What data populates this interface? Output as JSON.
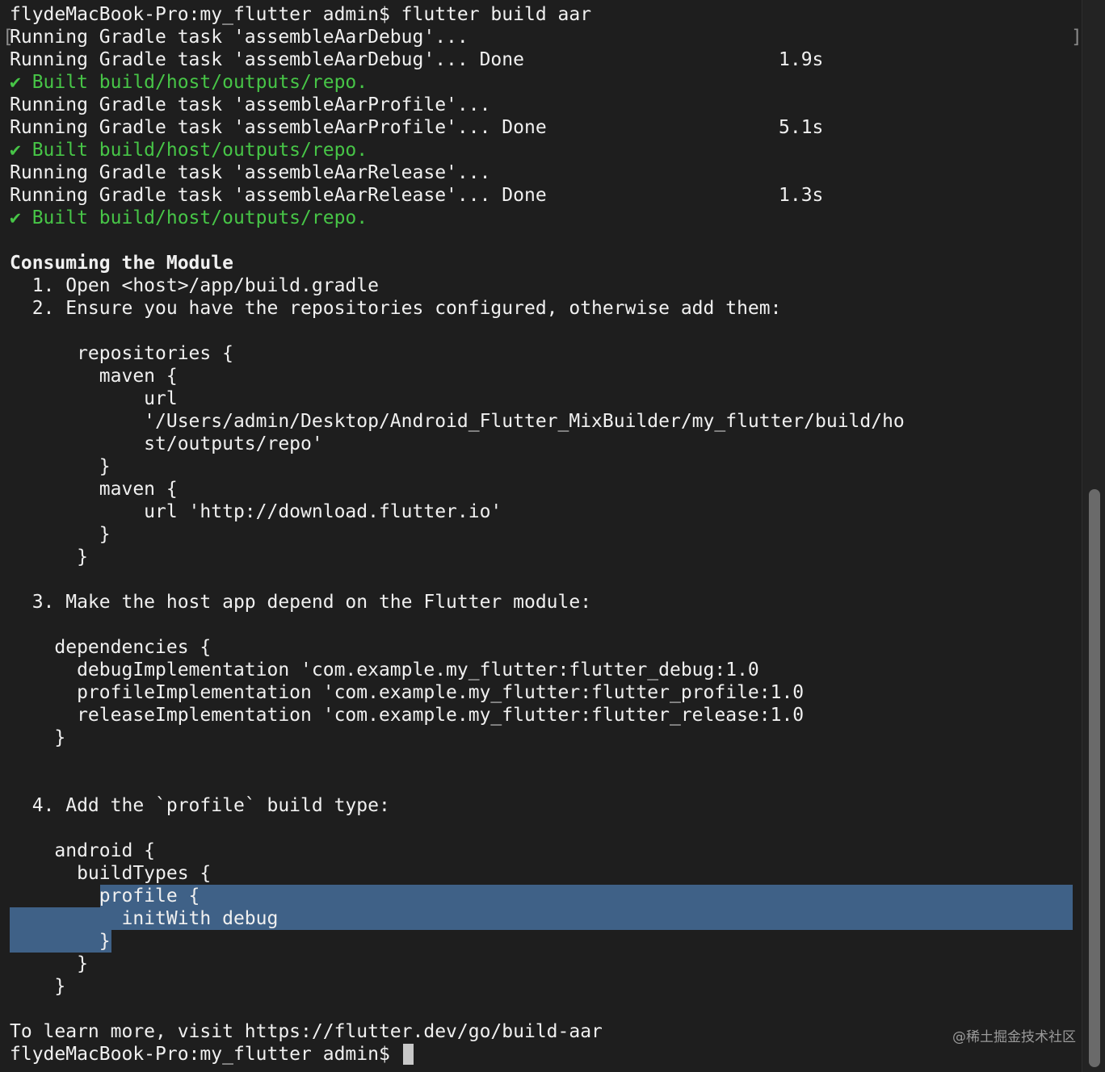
{
  "terminal": {
    "lines": [
      {
        "text": "flydeMacBook-Pro:my_flutter admin$ flutter build aar"
      },
      {
        "text": "Running Gradle task 'assembleAarDebug'...",
        "bracketed": true
      },
      {
        "text": "Running Gradle task 'assembleAarDebug'... Done",
        "duration": "1.9s"
      },
      {
        "text": "✔ Built build/host/outputs/repo.",
        "style": "green"
      },
      {
        "text": "Running Gradle task 'assembleAarProfile'..."
      },
      {
        "text": "Running Gradle task 'assembleAarProfile'... Done",
        "duration": "5.1s"
      },
      {
        "text": "✔ Built build/host/outputs/repo.",
        "style": "green"
      },
      {
        "text": "Running Gradle task 'assembleAarRelease'..."
      },
      {
        "text": "Running Gradle task 'assembleAarRelease'... Done",
        "duration": "1.3s"
      },
      {
        "text": "✔ Built build/host/outputs/repo.",
        "style": "green"
      },
      {
        "text": ""
      },
      {
        "text": "Consuming the Module",
        "style": "bold"
      },
      {
        "text": "  1. Open <host>/app/build.gradle"
      },
      {
        "text": "  2. Ensure you have the repositories configured, otherwise add them:"
      },
      {
        "text": ""
      },
      {
        "text": "      repositories {"
      },
      {
        "text": "        maven {"
      },
      {
        "text": "            url"
      },
      {
        "text": "            '/Users/admin/Desktop/Android_Flutter_MixBuilder/my_flutter/build/ho"
      },
      {
        "text": "            st/outputs/repo'"
      },
      {
        "text": "        }"
      },
      {
        "text": "        maven {"
      },
      {
        "text": "            url 'http://download.flutter.io'"
      },
      {
        "text": "        }"
      },
      {
        "text": "      }"
      },
      {
        "text": ""
      },
      {
        "text": "  3. Make the host app depend on the Flutter module:"
      },
      {
        "text": ""
      },
      {
        "text": "    dependencies {"
      },
      {
        "text": "      debugImplementation 'com.example.my_flutter:flutter_debug:1.0"
      },
      {
        "text": "      profileImplementation 'com.example.my_flutter:flutter_profile:1.0"
      },
      {
        "text": "      releaseImplementation 'com.example.my_flutter:flutter_release:1.0"
      },
      {
        "text": "    }"
      },
      {
        "text": ""
      },
      {
        "text": ""
      },
      {
        "text": "  4. Add the `profile` build type:"
      },
      {
        "text": ""
      },
      {
        "text": "    android {"
      },
      {
        "text": "      buildTypes {"
      },
      {
        "text": "        profile {",
        "selection": "from-text"
      },
      {
        "text": "          initWith debug",
        "selection": "full"
      },
      {
        "text": "        }",
        "selection": "to-text"
      },
      {
        "text": "      }"
      },
      {
        "text": "    }"
      },
      {
        "text": ""
      },
      {
        "text": "To learn more, visit https://flutter.dev/go/build-aar"
      },
      {
        "text": "flydeMacBook-Pro:my_flutter admin$ ",
        "cursor": true
      }
    ]
  },
  "watermark": "@稀土掘金技术社区",
  "colors": {
    "background": "#1e1e1e",
    "text": "#f0f0f0",
    "success": "#47c547",
    "selection": "#3f6187"
  }
}
